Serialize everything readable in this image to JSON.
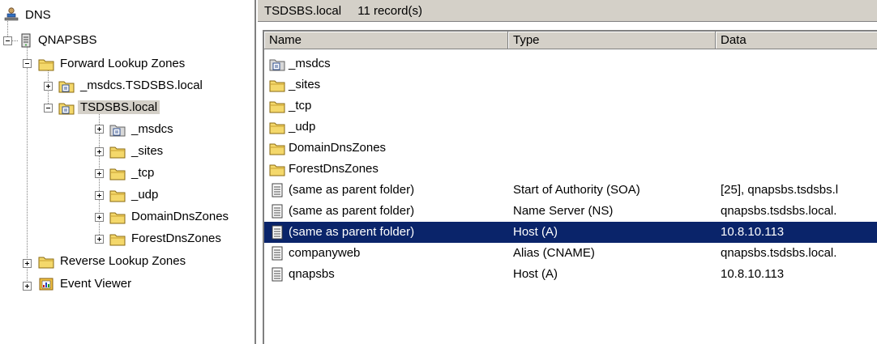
{
  "tree": {
    "root": {
      "label": "DNS",
      "icon": "dns-icon"
    },
    "server": {
      "label": "QNAPSBS",
      "icon": "server-icon"
    },
    "forward_zones": {
      "label": "Forward Lookup Zones",
      "icon": "folder-icon"
    },
    "zone_msdcs": {
      "label": "_msdcs.TSDSBS.local",
      "icon": "zone-icon"
    },
    "zone_tsdsbs": {
      "label": "TSDSBS.local",
      "icon": "zone-icon"
    },
    "zone_children": [
      {
        "label": "_msdcs",
        "icon": "delegated-zone-icon"
      },
      {
        "label": "_sites",
        "icon": "folder-icon"
      },
      {
        "label": "_tcp",
        "icon": "folder-icon"
      },
      {
        "label": "_udp",
        "icon": "folder-icon"
      },
      {
        "label": "DomainDnsZones",
        "icon": "folder-icon"
      },
      {
        "label": "ForestDnsZones",
        "icon": "folder-icon"
      }
    ],
    "reverse_zones": {
      "label": "Reverse Lookup Zones",
      "icon": "folder-icon"
    },
    "event_viewer": {
      "label": "Event Viewer",
      "icon": "event-viewer-icon"
    }
  },
  "list": {
    "title_zone": "TSDSBS.local",
    "title_count": "11 record(s)",
    "columns": {
      "name": "Name",
      "type": "Type",
      "data": "Data"
    },
    "rows": [
      {
        "name": "_msdcs",
        "type": "",
        "data": "",
        "icon": "delegated-zone-icon"
      },
      {
        "name": "_sites",
        "type": "",
        "data": "",
        "icon": "folder-icon"
      },
      {
        "name": "_tcp",
        "type": "",
        "data": "",
        "icon": "folder-icon"
      },
      {
        "name": "_udp",
        "type": "",
        "data": "",
        "icon": "folder-icon"
      },
      {
        "name": "DomainDnsZones",
        "type": "",
        "data": "",
        "icon": "folder-icon"
      },
      {
        "name": "ForestDnsZones",
        "type": "",
        "data": "",
        "icon": "folder-icon"
      },
      {
        "name": "(same as parent folder)",
        "type": "Start of Authority (SOA)",
        "data": "[25], qnapsbs.tsdsbs.l",
        "icon": "record-icon"
      },
      {
        "name": "(same as parent folder)",
        "type": "Name Server (NS)",
        "data": "qnapsbs.tsdsbs.local.",
        "icon": "record-icon"
      },
      {
        "name": "(same as parent folder)",
        "type": "Host (A)",
        "data": "10.8.10.113",
        "icon": "record-icon",
        "selected": true
      },
      {
        "name": "companyweb",
        "type": "Alias (CNAME)",
        "data": "qnapsbs.tsdsbs.local.",
        "icon": "record-icon"
      },
      {
        "name": "qnapsbs",
        "type": "Host (A)",
        "data": "10.8.10.113",
        "icon": "record-icon"
      }
    ]
  },
  "colors": {
    "selection": "#0a246a",
    "chrome": "#d4d0c8",
    "folder": "#f4d86b"
  }
}
